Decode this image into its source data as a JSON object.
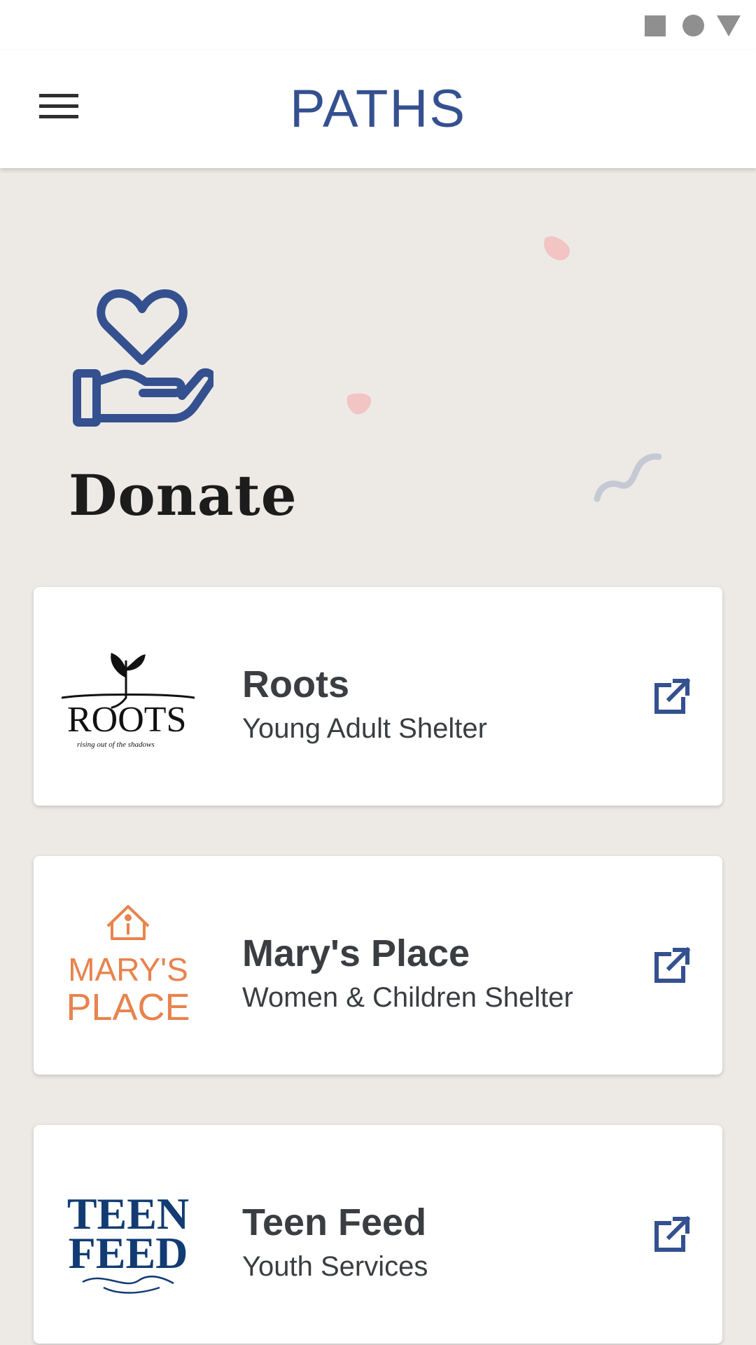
{
  "app": {
    "title": "PATHS"
  },
  "page": {
    "title": "Donate"
  },
  "colors": {
    "brand": "#34508f",
    "background": "#edeae6",
    "card": "#ffffff",
    "text": "#3a3d41",
    "marys_place": "#e8834e"
  },
  "icons": {
    "status": [
      "stop-square-icon",
      "record-circle-icon",
      "signal-triangle-icon"
    ],
    "menu": "hamburger-menu-icon",
    "donate": "heart-in-hand-icon",
    "external": "external-link-icon"
  },
  "organizations": [
    {
      "name": "Roots",
      "subtitle": "Young Adult Shelter",
      "logo_text": "ROOTS",
      "logo_tagline": "rising out of the shadows"
    },
    {
      "name": "Mary's Place",
      "subtitle": "Women & Children Shelter",
      "logo_line1": "MARY'S",
      "logo_line2": "PLACE"
    },
    {
      "name": "Teen Feed",
      "subtitle": "Youth Services",
      "logo_line1": "TEEN",
      "logo_line2": "FEED"
    }
  ]
}
